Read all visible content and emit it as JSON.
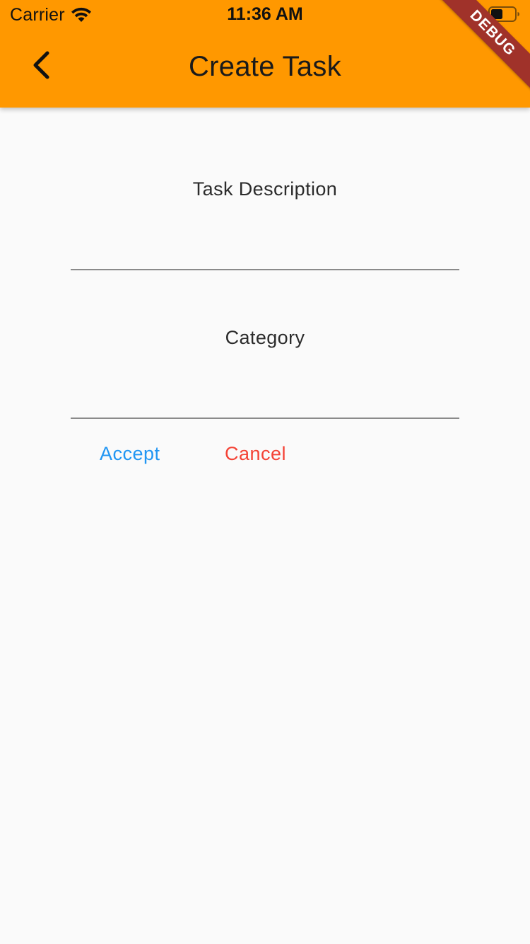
{
  "status_bar": {
    "carrier": "Carrier",
    "time": "11:36 AM",
    "icons": [
      "wifi-icon",
      "battery-icon"
    ]
  },
  "app_bar": {
    "title": "Create Task",
    "back_icon": "chevron-left-icon",
    "background_color": "#ff9800"
  },
  "debug_banner": {
    "label": "DEBUG",
    "color": "#a0322a"
  },
  "form": {
    "task_description": {
      "label": "Task Description",
      "value": ""
    },
    "category": {
      "label": "Category",
      "value": ""
    }
  },
  "actions": {
    "accept_label": "Accept",
    "accept_color": "#2196f3",
    "cancel_label": "Cancel",
    "cancel_color": "#f44336"
  }
}
